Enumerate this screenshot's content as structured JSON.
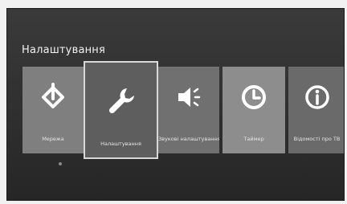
{
  "screen": {
    "title": "Налаштування"
  },
  "tiles": [
    {
      "label": "Мережа",
      "icon": "network-icon"
    },
    {
      "label": "Налаштування",
      "icon": "wrench-icon",
      "selected": true
    },
    {
      "label": "Звукові налаштування",
      "icon": "speaker-icon"
    },
    {
      "label": "Таймер",
      "icon": "clock-icon"
    },
    {
      "label": "Відомості про ТВ",
      "icon": "info-icon"
    }
  ],
  "colors": {
    "background": "#2f2f2f",
    "tile": "#7c7c7c",
    "selected_tile": "#5e5e5e",
    "focus_border": "#d8d8d8",
    "text": "#f2f2f2"
  }
}
